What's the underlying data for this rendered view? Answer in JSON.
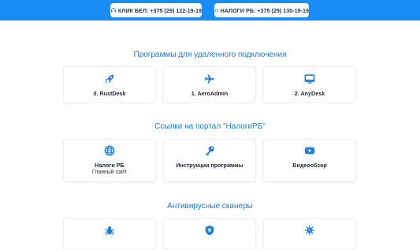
{
  "header": {
    "contact1": "КЛИК БЕЛ: +375 (29) 122-19-19",
    "contact2": "НАЛОГИ РБ: +375 (29) 130-19-19"
  },
  "sections": [
    {
      "title": "Программы для удаленного подключения",
      "cards": [
        {
          "label": "0. RustDesk",
          "icon": "rocket-icon"
        },
        {
          "label": "1. AeroAdmin",
          "icon": "airplane-icon"
        },
        {
          "label": "2. AnyDesk",
          "icon": "monitor-icon"
        }
      ]
    },
    {
      "title": "Ссылки на портал \"НалогиРБ\"",
      "cards": [
        {
          "label": "Налоги РБ",
          "sub": "Главный сайт",
          "icon": "globe-icon"
        },
        {
          "label": "Инструкции программы",
          "icon": "key-icon"
        },
        {
          "label": "Видеообзор",
          "icon": "youtube-icon"
        }
      ]
    },
    {
      "title": "Антивирусные сканеры",
      "cards": [
        {
          "label": "",
          "icon": "bug-icon"
        },
        {
          "label": "",
          "icon": "shield-icon"
        },
        {
          "label": "",
          "icon": "virus-icon"
        }
      ]
    }
  ],
  "colors": {
    "accent": "#1a8cf5",
    "title": "#1a7fe0",
    "icon": "#1a7fe0"
  }
}
